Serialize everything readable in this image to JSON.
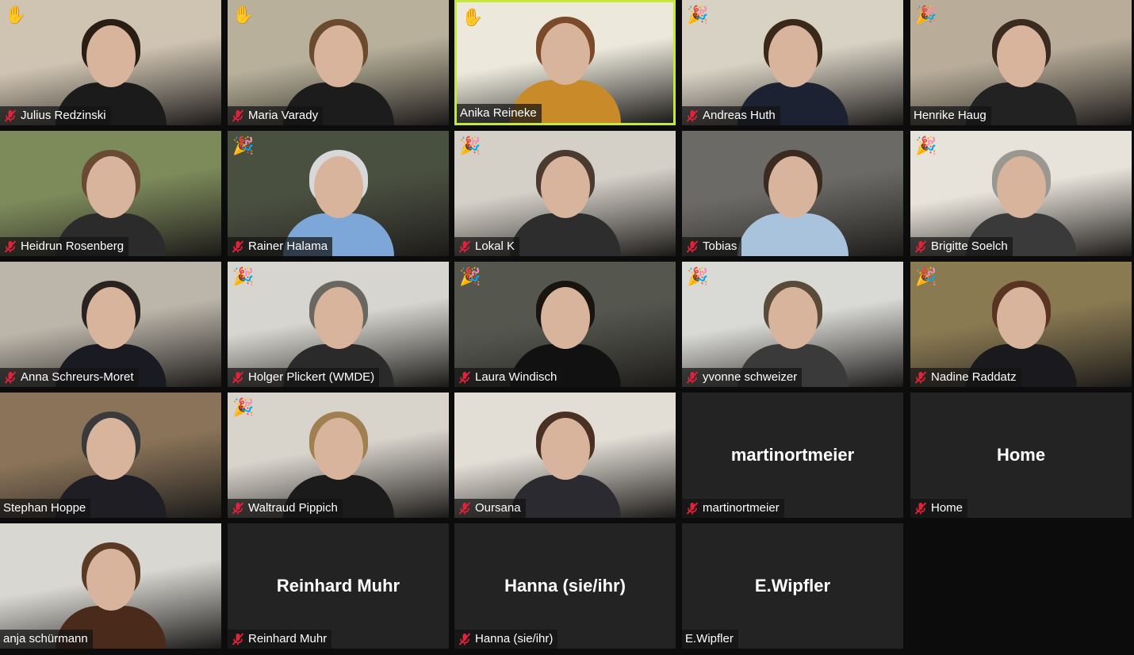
{
  "meeting": {
    "participants": [
      {
        "name": "Julius Redzinski",
        "muted": true,
        "reaction": "raised-hand",
        "video": true,
        "bg": "#cfc3b2",
        "shirt": "#1b1b1b",
        "hair": "#2a1d14"
      },
      {
        "name": "Maria Varady",
        "muted": true,
        "reaction": "raised-hand",
        "video": true,
        "bg": "#b8b09a",
        "shirt": "#1c1c1c",
        "hair": "#6b4a2e"
      },
      {
        "name": "Anika Reineke",
        "muted": false,
        "reaction": "raised-hand",
        "video": true,
        "active": true,
        "bg": "#ece9dc",
        "shirt": "#c98a2a",
        "hair": "#7a4a2a"
      },
      {
        "name": "Andreas Huth",
        "muted": true,
        "reaction": "party-popper",
        "video": true,
        "bg": "#d8d2c4",
        "shirt": "#1d2233",
        "hair": "#3a2818"
      },
      {
        "name": "Henrike Haug",
        "muted": false,
        "reaction": "party-popper",
        "video": true,
        "bg": "#b9ad9a",
        "shirt": "#222222",
        "hair": "#3b2a20"
      },
      {
        "name": "Heidrun Rosenberg",
        "muted": true,
        "reaction": "",
        "video": true,
        "bg": "#7d8a5a",
        "shirt": "#2b2b2b",
        "hair": "#6b4a34"
      },
      {
        "name": "Rainer Halama",
        "muted": true,
        "reaction": "party-popper",
        "video": true,
        "bg": "#4a5040",
        "shirt": "#7da7d8",
        "hair": "#d8d8d8"
      },
      {
        "name": "Lokal K",
        "muted": true,
        "reaction": "party-popper",
        "video": true,
        "bg": "#d4d0c8",
        "shirt": "#2d2d2d",
        "hair": "#4a3a30"
      },
      {
        "name": "Tobias",
        "muted": true,
        "reaction": "",
        "video": true,
        "bg": "#6c6a66",
        "shirt": "#a9c3dc",
        "hair": "#3a2a20"
      },
      {
        "name": "Brigitte Soelch",
        "muted": true,
        "reaction": "party-popper",
        "video": true,
        "bg": "#e7e3da",
        "shirt": "#3a3a3a",
        "hair": "#9a9690"
      },
      {
        "name": "Anna Schreurs-Moret",
        "muted": true,
        "reaction": "",
        "video": true,
        "bg": "#bcb6aa",
        "shirt": "#1a1a22",
        "hair": "#2a2220"
      },
      {
        "name": "Holger Plickert (WMDE)",
        "muted": true,
        "reaction": "party-popper",
        "video": true,
        "bg": "#d7d5cf",
        "shirt": "#2a2a2a",
        "hair": "#6a6660"
      },
      {
        "name": "Laura Windisch",
        "muted": true,
        "reaction": "party-popper",
        "video": true,
        "bg": "#55574f",
        "shirt": "#111111",
        "hair": "#1a1410"
      },
      {
        "name": "yvonne schweizer",
        "muted": true,
        "reaction": "party-popper",
        "video": true,
        "bg": "#d9d9d6",
        "shirt": "#3a3a3a",
        "hair": "#5a4a3a"
      },
      {
        "name": "Nadine Raddatz",
        "muted": true,
        "reaction": "party-popper",
        "video": true,
        "bg": "#8a7a52",
        "shirt": "#1a1a1e",
        "hair": "#5a3422"
      },
      {
        "name": "Stephan Hoppe",
        "muted": false,
        "reaction": "",
        "video": true,
        "bg": "#8a7358",
        "shirt": "#1e1e24",
        "hair": "#3a3a3a"
      },
      {
        "name": "Waltraud Pippich",
        "muted": true,
        "reaction": "party-popper",
        "video": true,
        "bg": "#d8d4cc",
        "shirt": "#1b1b1b",
        "hair": "#a08050"
      },
      {
        "name": "Oursana",
        "muted": true,
        "reaction": "",
        "video": true,
        "bg": "#e2ded6",
        "shirt": "#2a2a30",
        "hair": "#4a3024"
      },
      {
        "name": "martinortmeier",
        "muted": true,
        "reaction": "",
        "video": false,
        "display": "martinortmeier"
      },
      {
        "name": "Home",
        "muted": true,
        "reaction": "",
        "video": false,
        "display": "Home"
      },
      {
        "name": "anja schürmann",
        "muted": false,
        "reaction": "",
        "video": true,
        "bg": "#d9d7d2",
        "shirt": "#4a2a1a",
        "hair": "#5a3a24"
      },
      {
        "name": "Reinhard Muhr",
        "muted": true,
        "reaction": "",
        "video": false,
        "display": "Reinhard Muhr"
      },
      {
        "name": "Hanna (sie/ihr)",
        "muted": true,
        "reaction": "",
        "video": false,
        "display": "Hanna (sie/ihr)"
      },
      {
        "name": "E.Wipfler",
        "muted": false,
        "reaction": "",
        "video": false,
        "display": "E.Wipfler"
      }
    ]
  },
  "colors": {
    "active_border": "#c6e83a",
    "mic_off": "#e0223a",
    "tile_dark": "#232323"
  }
}
